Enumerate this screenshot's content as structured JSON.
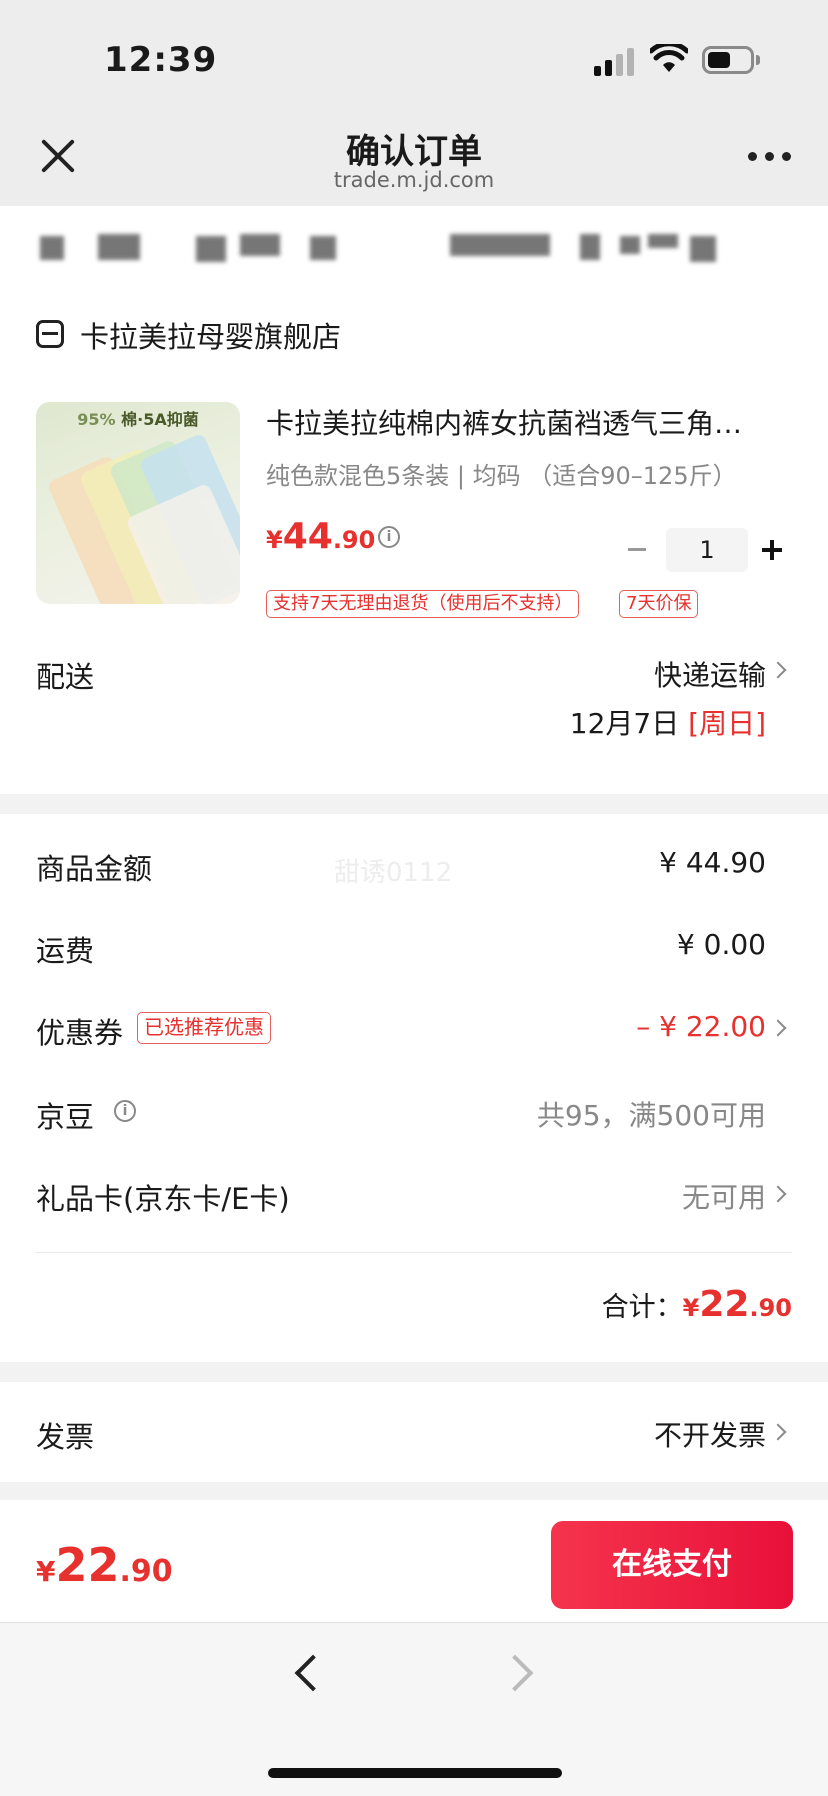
{
  "status_bar": {
    "time": "12:39"
  },
  "nav": {
    "title": "确认订单",
    "url": "trade.m.jd.com"
  },
  "shop": {
    "name": "卡拉美拉母婴旗舰店"
  },
  "product": {
    "image_tagline_a": "95%",
    "image_tagline_b": "棉·5A抑菌",
    "title": "卡拉美拉纯棉内裤女抗菌裆透气三角…",
    "spec": "纯色款混色5条装 | 均码 （适合90–125斤）",
    "price_currency": "¥",
    "price_int": "44",
    "price_dec": ".90",
    "quantity": "1",
    "tags": [
      "支持7天无理由退货（使用后不支持）",
      "7天价保"
    ]
  },
  "delivery": {
    "label": "配送",
    "method": "快递运输",
    "date": "12月7日",
    "weekday": "[周日]"
  },
  "summary": {
    "goods_amount_label": "商品金额",
    "goods_amount": "¥ 44.90",
    "watermark": "甜诱0112",
    "shipping_label": "运费",
    "shipping": "¥ 0.00",
    "coupon_label": "优惠券",
    "coupon_badge": "已选推荐优惠",
    "coupon_value": "– ¥ 22.00",
    "jingdou_label": "京豆",
    "jingdou_value": "共95，满500可用",
    "giftcard_label": "礼品卡(京东卡/E卡)",
    "giftcard_value": "无可用",
    "total_label": "合计：",
    "total_currency": "¥",
    "total_int": "22",
    "total_dec": ".90"
  },
  "invoice": {
    "label": "发票",
    "value": "不开发票"
  },
  "pay": {
    "currency": "¥",
    "int": "22",
    "dec": ".90",
    "button_label": "在线支付",
    "accent_color": "#e6312e"
  }
}
